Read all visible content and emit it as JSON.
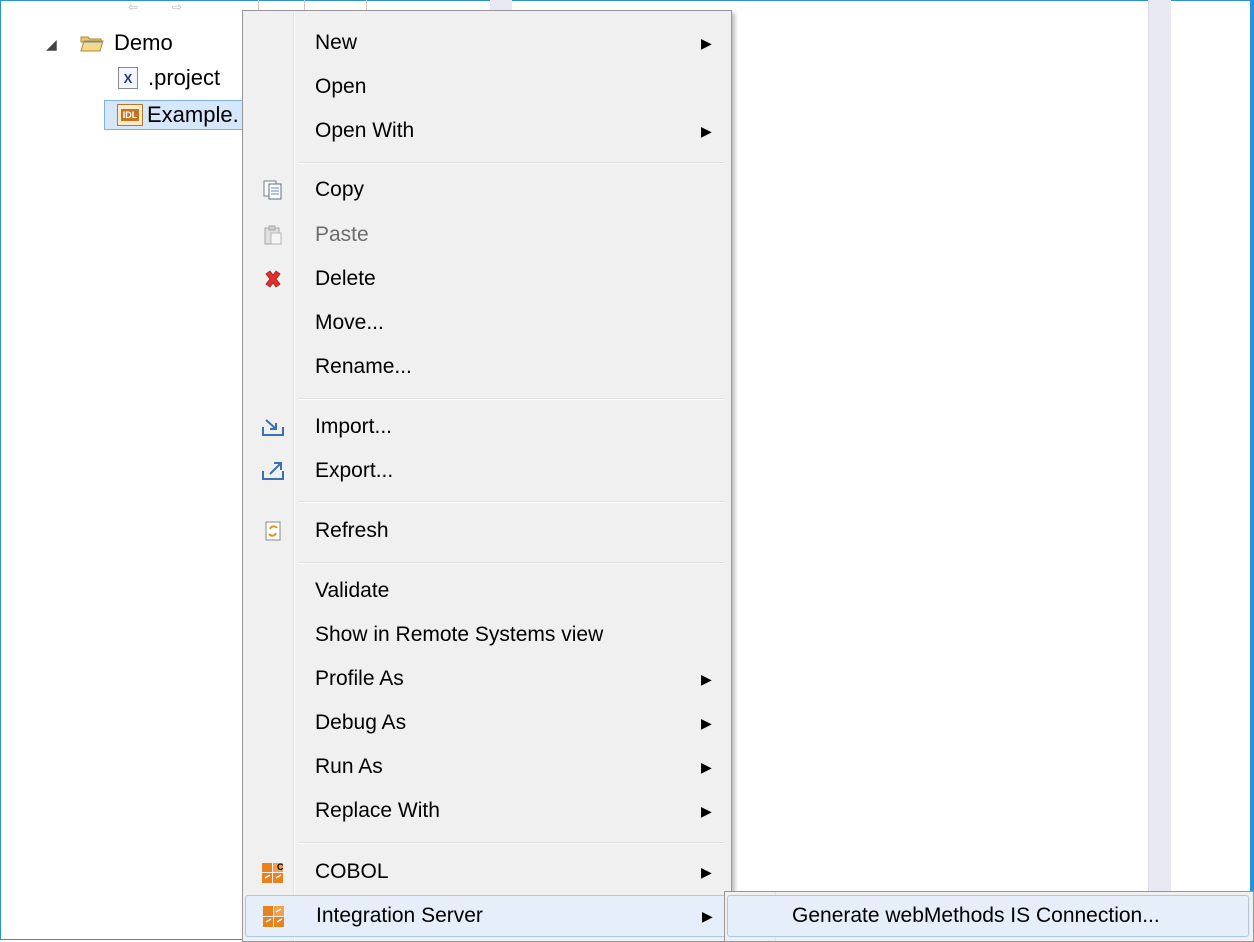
{
  "tree": {
    "project": {
      "label": "Demo",
      "icon": "folder-open-icon"
    },
    "children": [
      {
        "label": ".project",
        "icon": "xml-file-icon",
        "icon_text": "X"
      },
      {
        "label": "Example.",
        "icon": "idl-file-icon",
        "icon_text": "IDL",
        "selected": true
      }
    ]
  },
  "context_menu": {
    "items": [
      {
        "label": "New",
        "submenu": true
      },
      {
        "label": "Open"
      },
      {
        "label": "Open With",
        "submenu": true
      },
      {
        "label": "Copy",
        "icon": "copy-icon"
      },
      {
        "label": "Paste",
        "icon": "paste-icon",
        "disabled": true
      },
      {
        "label": "Delete",
        "icon": "delete-icon"
      },
      {
        "label": "Move..."
      },
      {
        "label": "Rename..."
      },
      {
        "label": "Import...",
        "icon": "import-icon"
      },
      {
        "label": "Export...",
        "icon": "export-icon"
      },
      {
        "label": "Refresh",
        "icon": "refresh-icon"
      },
      {
        "label": "Validate"
      },
      {
        "label": "Show in Remote Systems view"
      },
      {
        "label": "Profile As",
        "submenu": true
      },
      {
        "label": "Debug As",
        "submenu": true
      },
      {
        "label": "Run As",
        "submenu": true
      },
      {
        "label": "Replace With",
        "submenu": true
      },
      {
        "label": "COBOL",
        "icon": "cobol-icon",
        "submenu": true
      },
      {
        "label": "Integration Server",
        "icon": "integration-server-icon",
        "submenu": true,
        "highlighted": true
      }
    ]
  },
  "submenu": {
    "items": [
      {
        "label": "Generate webMethods IS Connection...",
        "highlighted": true
      }
    ]
  },
  "colors": {
    "window_border": "#2b91d9",
    "menu_background": "#f0f0f0",
    "highlight": "#e5eef9",
    "delete_red": "#e0302b",
    "webmethods_orange": "#e8821e"
  }
}
